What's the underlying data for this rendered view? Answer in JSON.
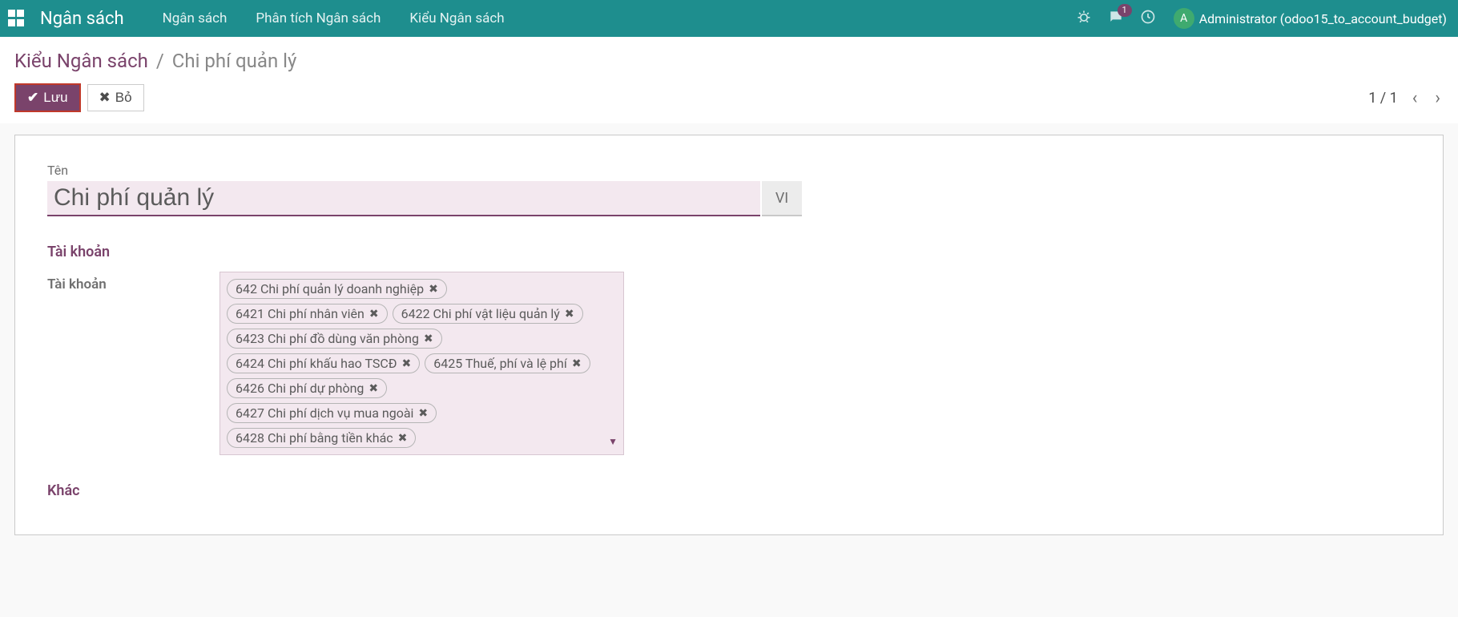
{
  "colors": {
    "primary": "#1e8e8e",
    "accent": "#7a436b"
  },
  "nav": {
    "brand": "Ngân sách",
    "items": [
      "Ngân sách",
      "Phân tích Ngân sách",
      "Kiểu Ngân sách"
    ],
    "msg_badge": "1",
    "avatar_letter": "A",
    "username": "Administrator (odoo15_to_account_budget)"
  },
  "breadcrumb": {
    "parent": "Kiểu Ngân sách",
    "separator": "/",
    "current": "Chi phí quản lý"
  },
  "buttons": {
    "save": "Lưu",
    "discard": "Bỏ"
  },
  "pager": {
    "text": "1 / 1"
  },
  "form": {
    "name_label": "Tên",
    "name_value": "Chi phí quản lý",
    "lang": "VI",
    "section_accounts": "Tài khoản",
    "accounts_label": "Tài khoản",
    "accounts": [
      "642 Chi phí quản lý doanh nghiệp",
      "6421 Chi phí nhân viên",
      "6422 Chi phí vật liệu quản lý",
      "6423 Chi phí đồ dùng văn phòng",
      "6424 Chi phí khấu hao TSCĐ",
      "6425 Thuế, phí và lệ phí",
      "6426 Chi phí dự phòng",
      "6427 Chi phí dịch vụ mua ngoài",
      "6428 Chi phí bằng tiền khác"
    ],
    "section_other": "Khác"
  }
}
